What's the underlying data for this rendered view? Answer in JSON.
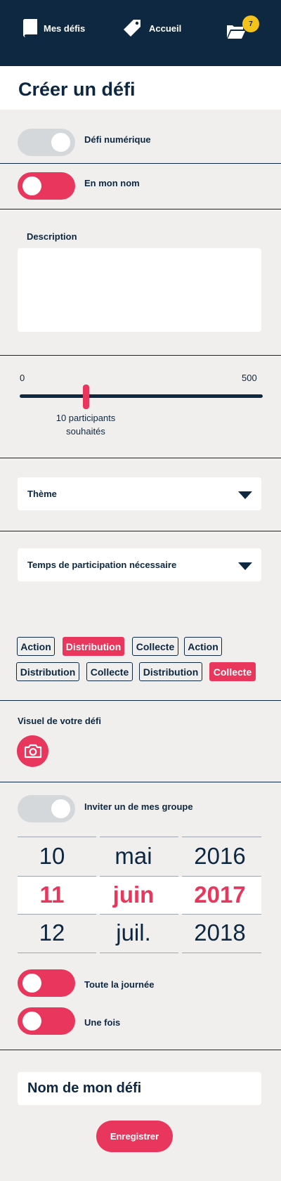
{
  "nav": {
    "mes_defis": "Mes défis",
    "accueil": "Accueil",
    "folder_badge": "7",
    "icons": [
      "book-icon",
      "tag-icon",
      "folder-icon"
    ]
  },
  "page": {
    "title": "Créer un défi"
  },
  "toggles": {
    "numerique": {
      "label": "Défi numérique",
      "on": false
    },
    "nom": {
      "label": "En mon nom",
      "on": true
    },
    "groupe": {
      "label": "Inviter un de mes groupe",
      "on": false
    },
    "journee": {
      "label": "Toute la journée",
      "on": true
    },
    "fois": {
      "label": "Une fois",
      "on": true
    }
  },
  "description": {
    "label": "Description",
    "value": ""
  },
  "participants": {
    "min": "0",
    "max": "500",
    "value": 10,
    "caption_line1": "10 participants",
    "caption_line2": "souhaités"
  },
  "selects": {
    "theme": "Thème",
    "temps": "Temps de participation nécessaire"
  },
  "tags": [
    {
      "label": "Action",
      "active": false
    },
    {
      "label": "Distribution",
      "active": true
    },
    {
      "label": "Collecte",
      "active": false
    },
    {
      "label": "Action",
      "active": false
    },
    {
      "label": "Distribution",
      "active": false
    },
    {
      "label": "Collecte",
      "active": false
    },
    {
      "label": "Distribution",
      "active": false
    },
    {
      "label": "Collecte",
      "active": true
    }
  ],
  "visuel": {
    "label": "Visuel de votre défi"
  },
  "date_picker": {
    "day": [
      "10",
      "11",
      "12"
    ],
    "month": [
      "mai",
      "juin",
      "juil."
    ],
    "year": [
      "2016",
      "2017",
      "2018"
    ],
    "selected_index": 1
  },
  "name_field": {
    "value": "Nom de mon défi"
  },
  "save_button": "Enregistrer",
  "colors": {
    "primary": "#0e2841",
    "accent": "#e8365c",
    "badge": "#f3c21b",
    "background": "#f1efee"
  }
}
